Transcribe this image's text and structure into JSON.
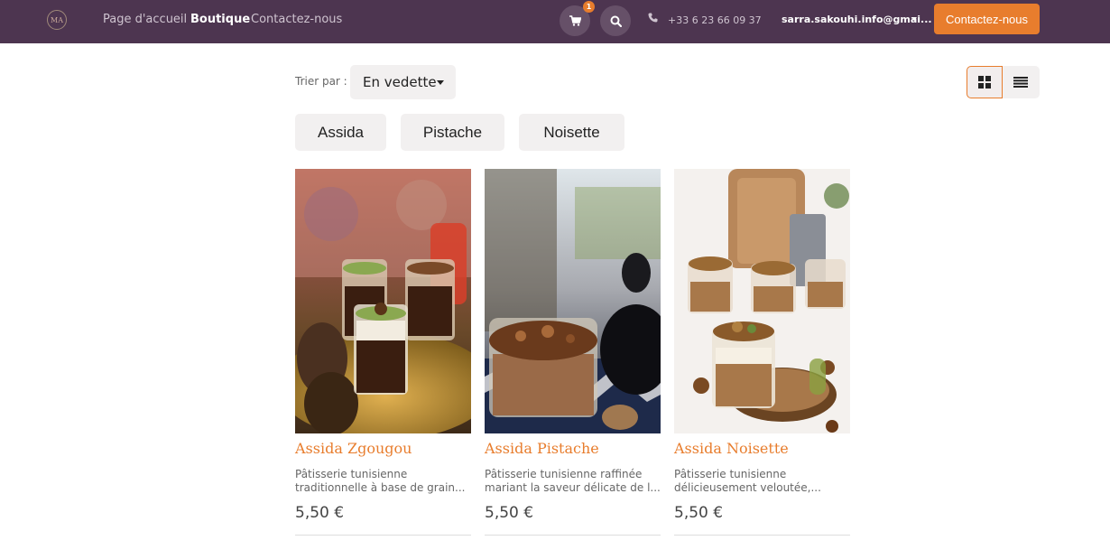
{
  "brand": {
    "logo_text": "MA"
  },
  "nav": {
    "links": [
      {
        "label": "Page d'accueil"
      },
      {
        "label": "Boutique"
      },
      {
        "label": "Contactez-nous"
      }
    ],
    "cart_count": "1",
    "phone": "+33 6 23 66 09 37",
    "user_email": "sarra.sakouhi.info@gmai...",
    "contact_button": "Contactez-nous"
  },
  "toolbar": {
    "sort_label": "Trier par :",
    "sort_value": "En vedette"
  },
  "categories": [
    {
      "label": "Assida"
    },
    {
      "label": "Pistache"
    },
    {
      "label": "Noisette"
    }
  ],
  "products": [
    {
      "name": "Assida Zgougou",
      "desc_line1": "Pâtisserie tunisienne",
      "desc_line2": "traditionnelle à base de grain...",
      "price": "5,50 €"
    },
    {
      "name": "Assida Pistache",
      "desc_line1": "Pâtisserie tunisienne raffinée",
      "desc_line2": "mariant la saveur délicate de l...",
      "price": "5,50 €"
    },
    {
      "name": "Assida Noisette",
      "desc_line1": "Pâtisserie tunisienne",
      "desc_line2": "délicieusement veloutée,...",
      "price": "5,50 €"
    }
  ],
  "colors": {
    "navbar": "#4d3550",
    "accent": "#e87d2d"
  }
}
